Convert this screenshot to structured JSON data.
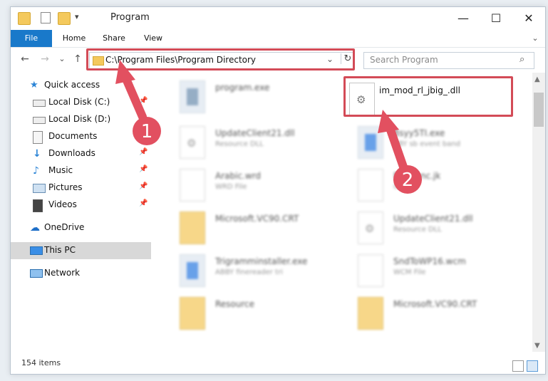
{
  "window": {
    "title": "Program"
  },
  "ribbon": {
    "tabs": [
      "File",
      "Home",
      "Share",
      "View"
    ]
  },
  "caption": {
    "minimize": "—",
    "maximize": "☐",
    "close": "✕"
  },
  "nav": {
    "back": "←",
    "forward": "→",
    "recent": "⌄",
    "up": "↑",
    "address": "C:\\Program Files\\Program Directory",
    "dropdown": "⌄",
    "refresh": "↻",
    "search_placeholder": "Search Program",
    "search_icon": "⌕"
  },
  "sidebar": {
    "items": [
      {
        "label": "Quick access",
        "icon": "star-icon",
        "pinned": false
      },
      {
        "label": "Local Disk (C:)",
        "icon": "drive-icon",
        "pinned": true
      },
      {
        "label": "Local Disk (D:)",
        "icon": "drive-icon",
        "pinned": false
      },
      {
        "label": "Documents",
        "icon": "documents-icon",
        "pinned": true
      },
      {
        "label": "Downloads",
        "icon": "download-icon",
        "pinned": true
      },
      {
        "label": "Music",
        "icon": "music-icon",
        "pinned": true
      },
      {
        "label": "Pictures",
        "icon": "pictures-icon",
        "pinned": true
      },
      {
        "label": "Videos",
        "icon": "videos-icon",
        "pinned": true
      },
      {
        "label": "OneDrive",
        "icon": "cloud-icon",
        "pinned": false
      },
      {
        "label": "This PC",
        "icon": "pc-icon",
        "pinned": false
      },
      {
        "label": "Network",
        "icon": "network-icon",
        "pinned": false
      }
    ],
    "pin_glyph": "📌"
  },
  "files": {
    "highlighted": {
      "name": "im_mod_rl_jbig_.dll",
      "icon": "dll-gear-icon"
    },
    "blurred": [
      {
        "name": "program.exe",
        "desc": ""
      },
      {
        "name": "UpdateClient21.dll",
        "desc": "Resource DLL"
      },
      {
        "name": "Bsyy5TI.exe",
        "desc": "BBY sb event band"
      },
      {
        "name": "Arabic.wrd",
        "desc": "WRD File"
      },
      {
        "name": "FastFunc.jk",
        "desc": "CK File"
      },
      {
        "name": "Microsoft.VC90.CRT",
        "desc": ""
      },
      {
        "name": "UpdateClient21.dll",
        "desc": "Resource DLL"
      },
      {
        "name": "Trigramminstaller.exe",
        "desc": "ABBY finereader tri"
      },
      {
        "name": "SndToWP16.wcm",
        "desc": "WCM File"
      },
      {
        "name": "Resource",
        "desc": ""
      },
      {
        "name": "Microsoft.VC90.CRT",
        "desc": ""
      }
    ]
  },
  "annotations": {
    "step1": "1",
    "step2": "2"
  },
  "status": {
    "item_count": "154 items"
  },
  "colors": {
    "accent": "#1979ca",
    "highlight": "#d34b57",
    "folder": "#f4c95d"
  }
}
